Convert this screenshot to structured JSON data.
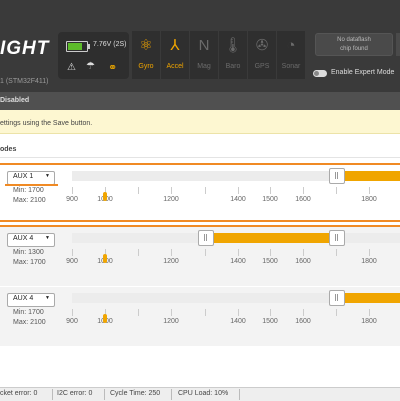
{
  "header": {
    "logo_text": "IGHT",
    "firmware_text": "1 (STM32F411)",
    "battery": {
      "voltage": "7.76V (2S)",
      "level": 0.8
    },
    "icons": [
      "warning-icon",
      "parachute-icon",
      "link-icon"
    ],
    "sensors": [
      {
        "label": "Gyro",
        "icon": "gyro-icon",
        "active": true
      },
      {
        "label": "Accel",
        "icon": "accel-icon",
        "active": true
      },
      {
        "label": "Mag",
        "icon": "mag-icon",
        "active": false
      },
      {
        "label": "Baro",
        "icon": "baro-icon",
        "active": false
      },
      {
        "label": "GPS",
        "icon": "gps-icon",
        "active": false
      },
      {
        "label": "Sonar",
        "icon": "sonar-icon",
        "active": false
      }
    ],
    "dataflash_line1": "No dataflash",
    "dataflash_line2": "chip found",
    "expert_mode_label": "Enable Expert Mode",
    "expert_mode_on": false
  },
  "status_strip": "Disabled",
  "notice": "ettings using the Save button.",
  "section_title": "odes",
  "ranges": [
    {
      "aux": "AUX 1",
      "min_label": "Min: 1700",
      "max_label": "Max: 2100",
      "min": 1700,
      "max": 2100,
      "current": 1000
    },
    {
      "aux": "AUX 4",
      "min_label": "Min: 1300",
      "max_label": "Max: 1700",
      "min": 1300,
      "max": 1700,
      "current": 1000
    },
    {
      "aux": "AUX 4",
      "min_label": "Min: 1700",
      "max_label": "Max: 2100",
      "min": 1700,
      "max": 2100,
      "current": 1000
    }
  ],
  "scale_labels": [
    "900",
    "1000",
    "1200",
    "1400",
    "1500",
    "1600",
    "1800"
  ],
  "footer": {
    "packet_error": "cket error: 0",
    "i2c_error": "I2C error: 0",
    "cycle_time": "Cycle Time: 250",
    "cpu_load": "CPU Load: 10%"
  },
  "colors": {
    "accent": "#f0a500",
    "highlight": "#f08a24",
    "topbar": "#3a3a3a"
  }
}
